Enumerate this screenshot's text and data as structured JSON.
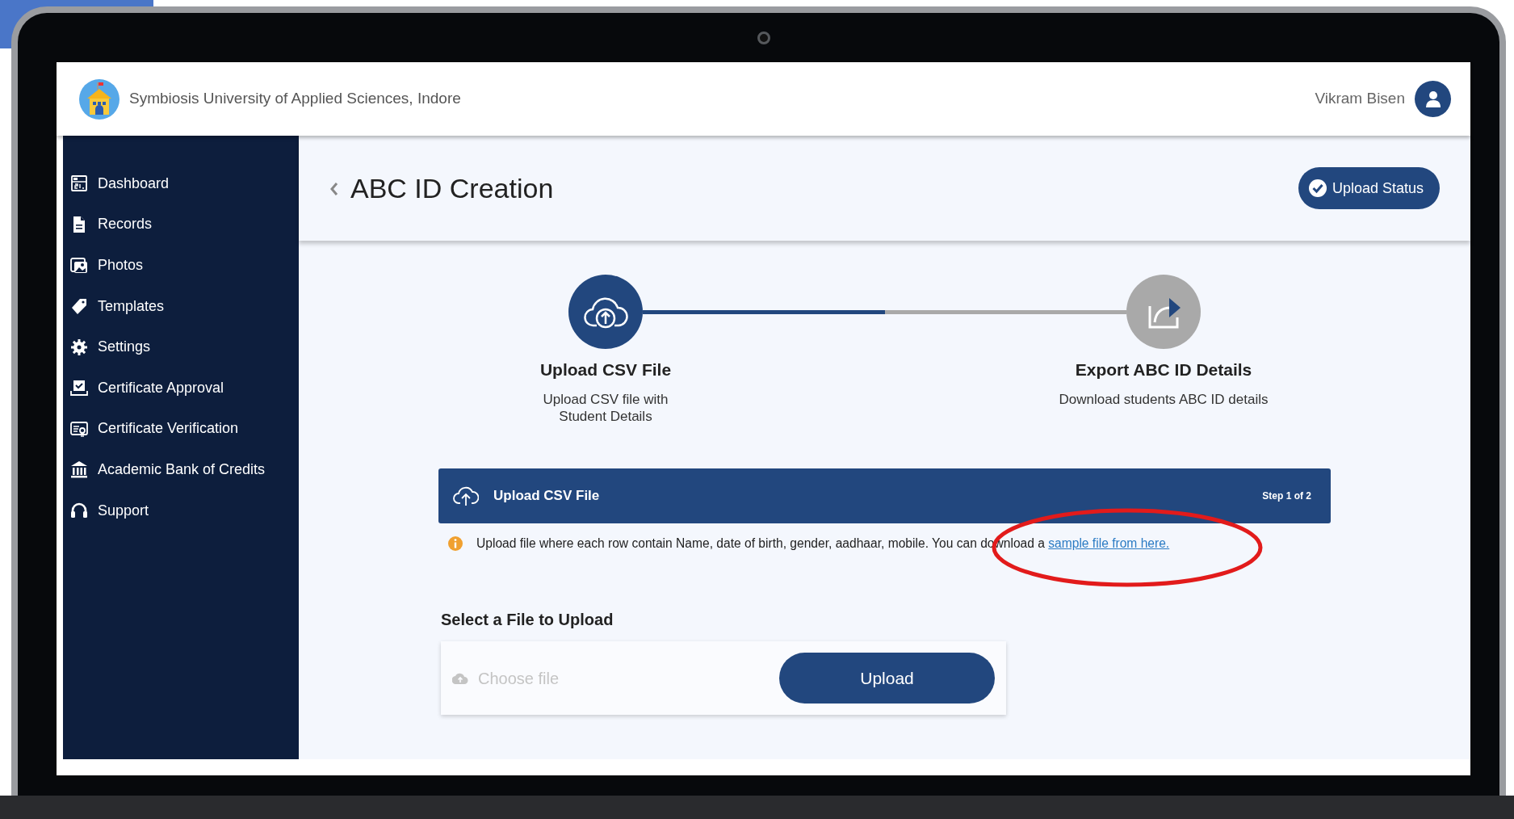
{
  "header": {
    "title": "Symbiosis University of Applied Sciences, Indore",
    "user": "Vikram Bisen"
  },
  "sidebar": {
    "items": [
      {
        "label": "Dashboard"
      },
      {
        "label": "Records"
      },
      {
        "label": "Photos"
      },
      {
        "label": "Templates"
      },
      {
        "label": "Settings"
      },
      {
        "label": "Certificate Approval"
      },
      {
        "label": "Certificate Verification"
      },
      {
        "label": "Academic Bank of Credits"
      },
      {
        "label": "Support"
      }
    ]
  },
  "page": {
    "title": "ABC ID Creation",
    "status_button": "Upload Status"
  },
  "steps": {
    "progress": {
      "level": 0.5
    },
    "items": [
      {
        "title": "Upload CSV File",
        "description": [
          "Upload CSV file with",
          "Student Details"
        ],
        "active": true
      },
      {
        "title": "Export ABC ID Details",
        "description": [
          "Download students ABC ID details"
        ],
        "active": false
      }
    ]
  },
  "upload_panel": {
    "title": "Upload CSV File",
    "step": "Step 1 of 2",
    "info": "Upload file where each row contain Name, date of birth, gender, aadhaar, mobile. You can download a",
    "link": "sample file from here.",
    "field_label": "Select a File to Upload",
    "file_field": {
      "placeholder": "Choose file"
    },
    "button": "Upload"
  }
}
